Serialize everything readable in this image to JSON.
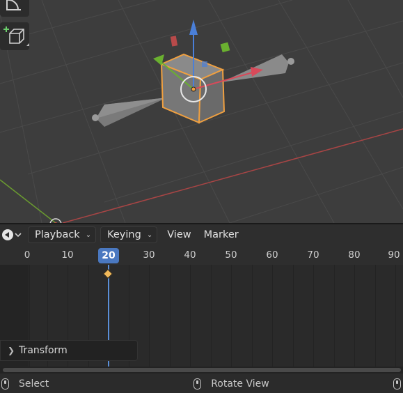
{
  "timeline": {
    "menus": {
      "playback": "Playback",
      "keying": "Keying",
      "view": "View",
      "marker": "Marker"
    },
    "ruler_ticks": [
      "0",
      "10",
      "20",
      "30",
      "40",
      "50",
      "60",
      "70",
      "80",
      "90"
    ],
    "current_frame": "20",
    "transform_panel_label": "Transform"
  },
  "statusbar": {
    "left_action": "Select",
    "middle_action": "Rotate View"
  },
  "colors": {
    "accent_blue": "#4a78c0",
    "selection_orange": "#f0a040",
    "axis_red": "#b84a4a",
    "axis_green": "#6a9a30"
  },
  "icons": [
    "measure-icon",
    "add-cube-icon",
    "editor-type-icon",
    "mouse-left-icon",
    "mouse-middle-icon",
    "mouse-right-icon"
  ]
}
